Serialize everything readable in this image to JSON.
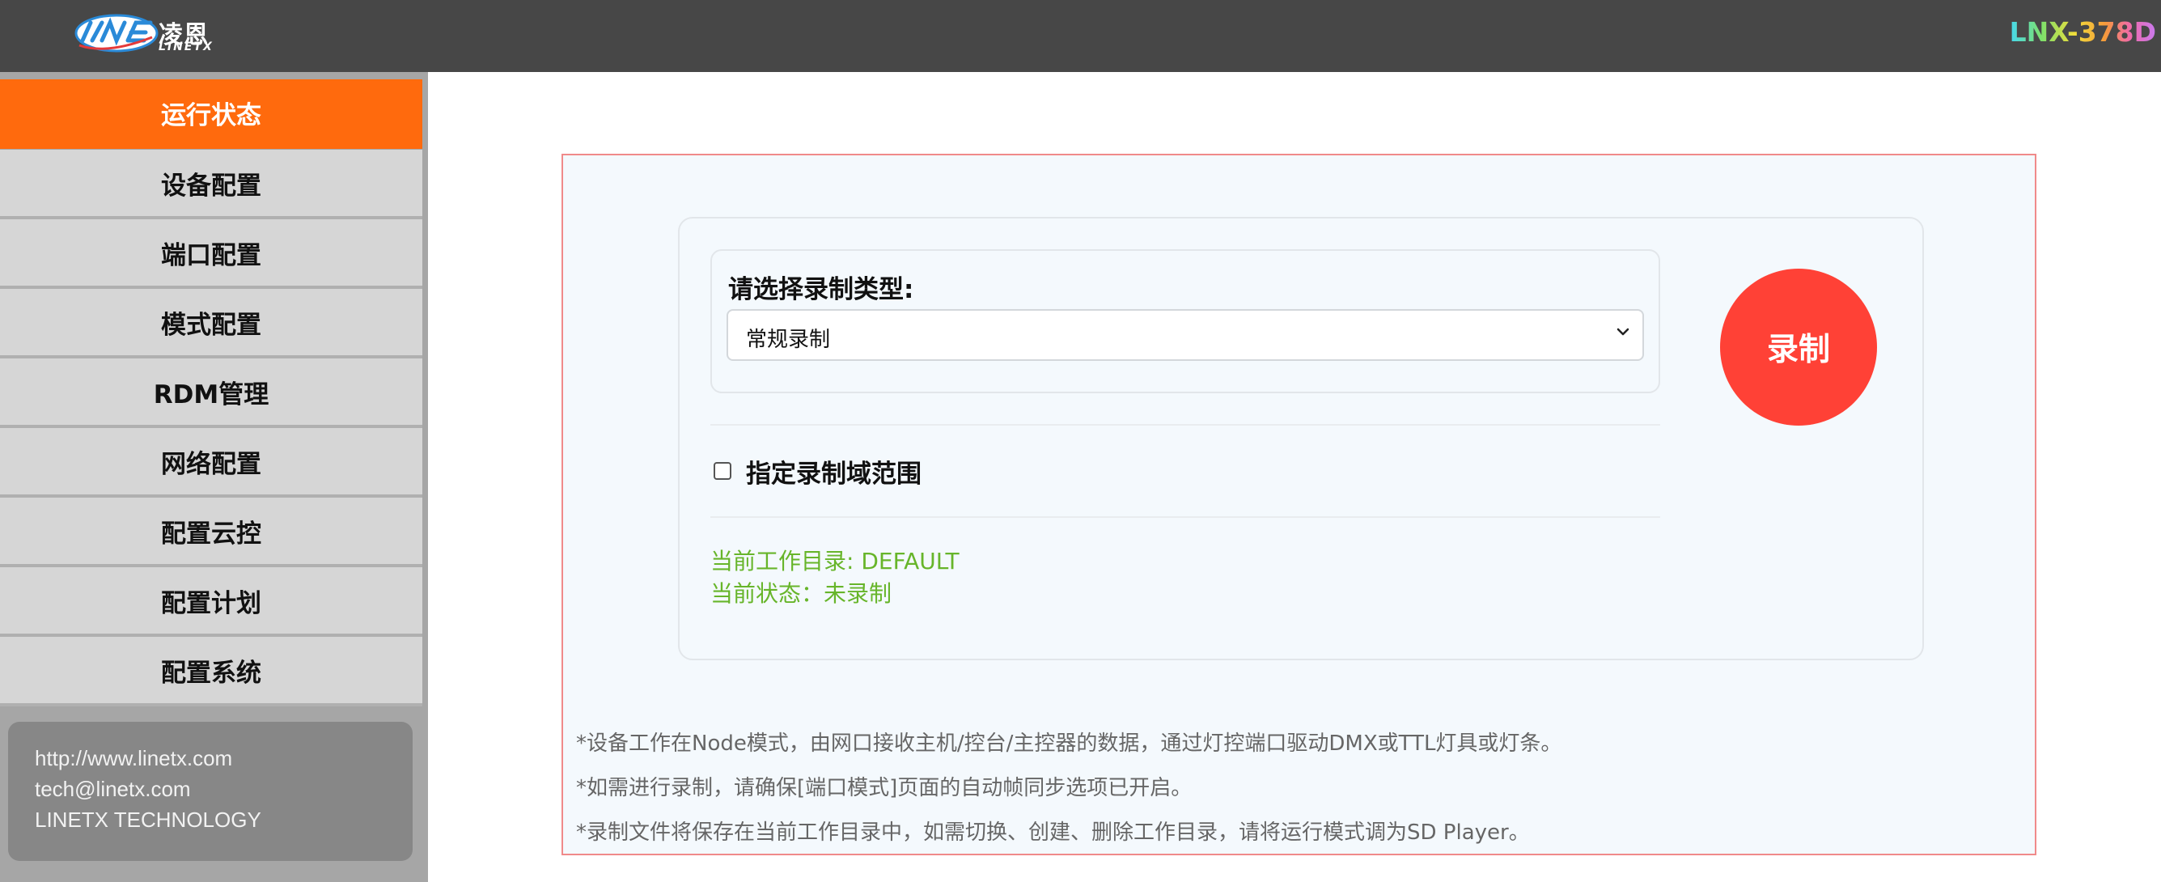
{
  "header": {
    "logo_cn": "凌恩",
    "logo_en": "LINETX",
    "model": "LNX-378D"
  },
  "sidebar": {
    "items": [
      {
        "label": "运行状态",
        "active": true
      },
      {
        "label": "设备配置",
        "active": false
      },
      {
        "label": "端口配置",
        "active": false
      },
      {
        "label": "模式配置",
        "active": false
      },
      {
        "label": "RDM管理",
        "active": false
      },
      {
        "label": "网络配置",
        "active": false
      },
      {
        "label": "配置云控",
        "active": false
      },
      {
        "label": "配置计划",
        "active": false
      },
      {
        "label": "配置系统",
        "active": false
      }
    ],
    "info": {
      "website": "http://www.linetx.com",
      "email": "tech@linetx.com",
      "company": "LINETX TECHNOLOGY"
    }
  },
  "main": {
    "record_type_label": "请选择录制类型:",
    "record_type_value": "常规录制",
    "record_button": "录制",
    "range_checkbox_label": "指定录制域范围",
    "range_checkbox_checked": false,
    "current_dir": "当前工作目录: DEFAULT",
    "current_status": "当前状态：未录制",
    "notes": [
      "*设备工作在Node模式，由网口接收主机/控台/主控器的数据，通过灯控端口驱动DMX或TTL灯具或灯条。",
      "*如需进行录制，请确保[端口模式]页面的自动帧同步选项已开启。",
      "*录制文件将保存在当前工作目录中，如需切换、创建、删除工作目录，请将运行模式调为SD Player。"
    ]
  },
  "colors": {
    "header_bg": "#474747",
    "active_nav": "#ff6a0d",
    "record_button": "#ff4136",
    "status_text": "#67b52a",
    "panel_border": "#f08a8a"
  }
}
